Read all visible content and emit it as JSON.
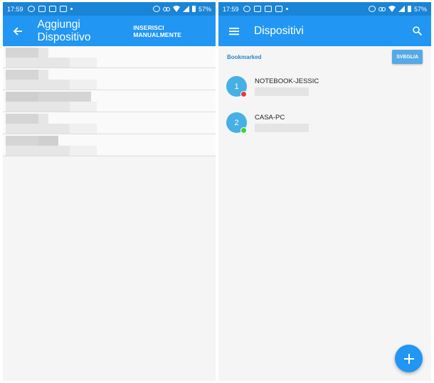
{
  "status_bar_left": {
    "time": "17:59",
    "battery": "57%"
  },
  "status_bar_right": {
    "time": "17:59",
    "battery": "57%"
  },
  "add_screen": {
    "back_icon": "arrow-left-icon",
    "title": "Aggiungi Dispositivo",
    "action_label": "INSERISCI MANUALMENTE",
    "row_count_visible": 5
  },
  "devices_screen": {
    "menu_icon": "hamburger-menu-icon",
    "title": "Dispositivi",
    "search_icon": "search-icon",
    "bookmarked_label": "Bookmarked",
    "wake_button_label": "SVEGLIA",
    "devices": [
      {
        "number": "1",
        "name": "NOTEBOOK-JESSIC",
        "status_color": "#e53935"
      },
      {
        "number": "2",
        "name": "CASA-PC",
        "status_color": "#43d12c"
      }
    ],
    "fab_icon": "plus-icon"
  },
  "colors": {
    "appbar": "#2196f3",
    "statusbar": "#1a84d6",
    "accent": "#2a86c9"
  }
}
